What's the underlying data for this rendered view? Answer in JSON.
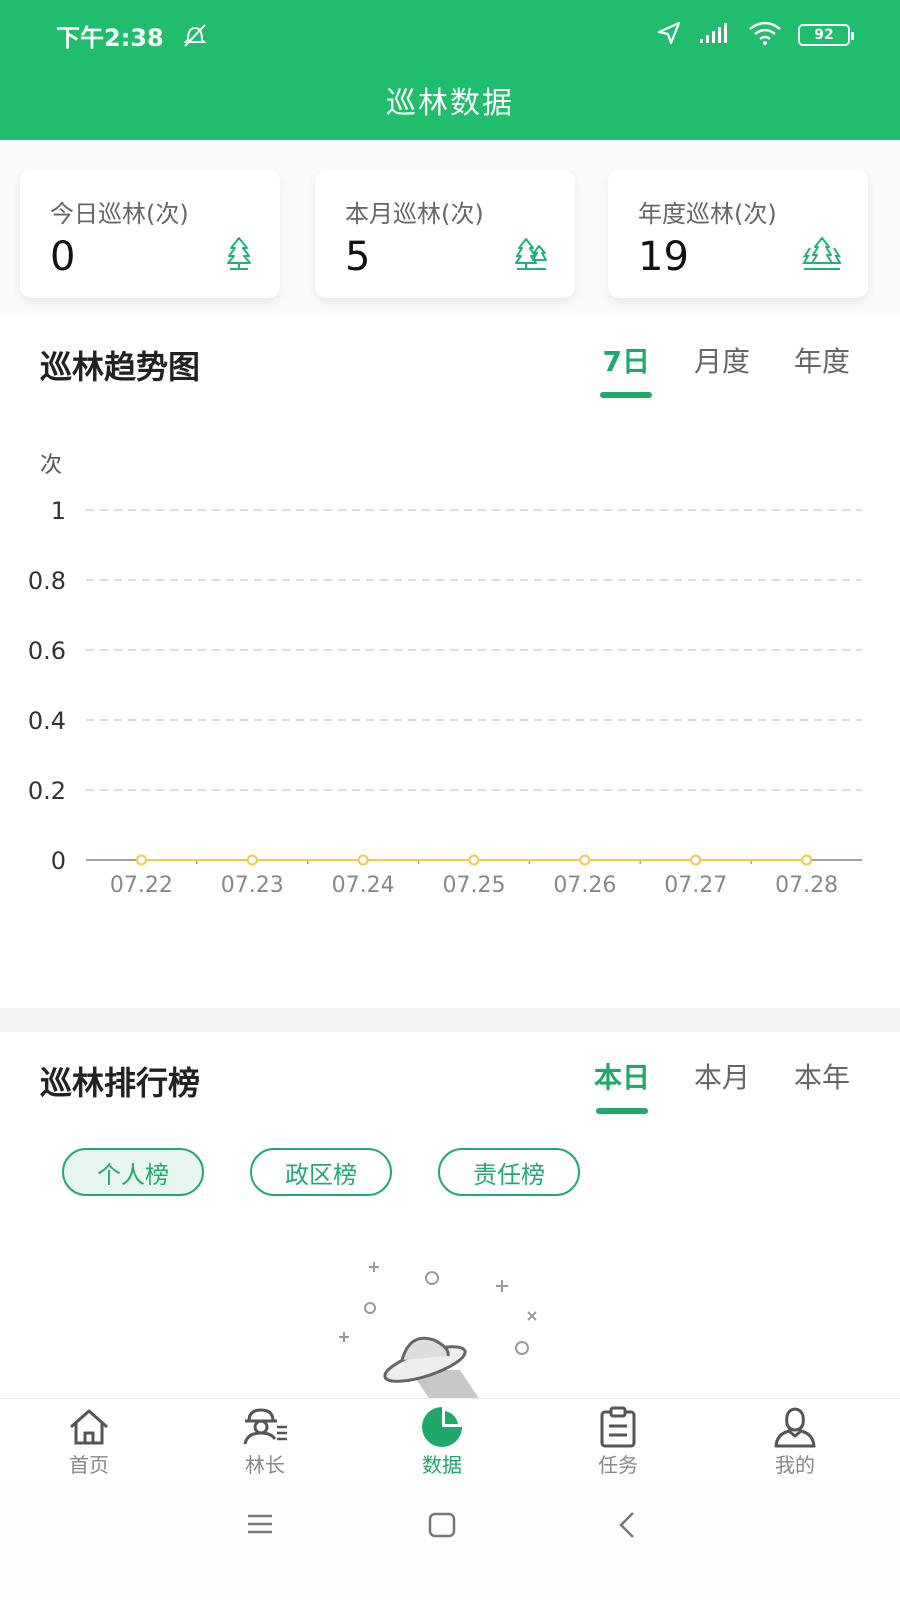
{
  "status_bar": {
    "time": "下午2:38",
    "battery": "92"
  },
  "header": {
    "title": "巡林数据"
  },
  "stats": [
    {
      "label": "今日巡林(次)",
      "value": "0"
    },
    {
      "label": "本月巡林(次)",
      "value": "5"
    },
    {
      "label": "年度巡林(次)",
      "value": "19"
    }
  ],
  "trend": {
    "title": "巡林趋势图",
    "tabs": [
      "7日",
      "月度",
      "年度"
    ],
    "active_tab": "7日"
  },
  "chart_data": {
    "type": "line",
    "x": [
      "07.22",
      "07.23",
      "07.24",
      "07.25",
      "07.26",
      "07.27",
      "07.28"
    ],
    "series": [
      {
        "values": [
          0,
          0,
          0,
          0,
          0,
          0,
          0
        ]
      }
    ],
    "ylabel": "次",
    "ylim": [
      0,
      1
    ],
    "yticks": [
      "0",
      "0.2",
      "0.4",
      "0.6",
      "0.8",
      "1"
    ],
    "grid": true,
    "colors": {
      "grid": "#c9d3de",
      "axis": "#9aa3ad",
      "point": "#f2c94c"
    }
  },
  "ranking": {
    "title": "巡林排行榜",
    "tabs": [
      "本日",
      "本月",
      "本年"
    ],
    "active_tab": "本日",
    "boards": [
      "个人榜",
      "政区榜",
      "责任榜"
    ],
    "active_board": "个人榜"
  },
  "nav": [
    {
      "label": "首页",
      "icon": "home-icon"
    },
    {
      "label": "林长",
      "icon": "ranger-icon"
    },
    {
      "label": "数据",
      "icon": "pie-chart-icon"
    },
    {
      "label": "任务",
      "icon": "clipboard-icon"
    },
    {
      "label": "我的",
      "icon": "user-icon"
    }
  ],
  "active_nav": "数据",
  "colors": {
    "brand": "#1fbd6c",
    "accent": "#1fa86a"
  }
}
